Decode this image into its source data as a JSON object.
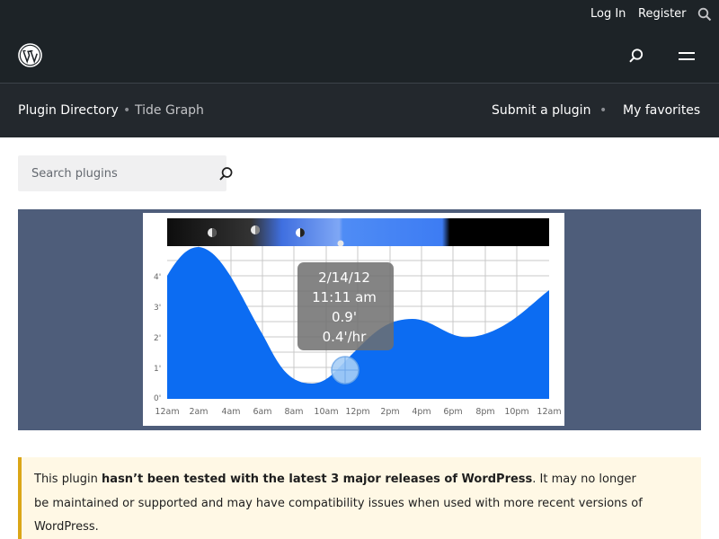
{
  "topbar": {
    "login": "Log In",
    "register": "Register",
    "search_icon": "search-icon"
  },
  "header": {
    "logo_icon": "wordpress-logo",
    "search_icon": "search-icon",
    "menu_icon": "menu-icon"
  },
  "subnav": {
    "breadcrumb_home": "Plugin Directory",
    "breadcrumb_sep": "•",
    "breadcrumb_current": "Tide Graph",
    "submit": "Submit a plugin",
    "sep": "•",
    "favorites": "My favorites"
  },
  "search": {
    "placeholder": "Search plugins",
    "icon": "search-icon"
  },
  "banner": {
    "tooltip": {
      "date": "2/14/12",
      "time": "11:11 am",
      "height": "0.9'",
      "rate": "0.4'/hr"
    },
    "y_ticks": [
      "4'",
      "3'",
      "2'",
      "1'",
      "0'"
    ],
    "x_ticks": [
      "12am",
      "2am",
      "4am",
      "6am",
      "8am",
      "10am",
      "12pm",
      "2pm",
      "4pm",
      "6pm",
      "8pm",
      "10pm",
      "12am"
    ]
  },
  "notice": {
    "prefix": "This plugin ",
    "bold": "hasn’t been tested with the latest 3 major releases of WordPress",
    "suffix": ". It may no longer be maintained or supported and may have compatibility issues when used with more recent versions of WordPress."
  },
  "colors": {
    "dark_bg": "#1d2327",
    "banner_bg": "#4e5d7a",
    "tide_blue": "#0c6cf2",
    "notice_bg": "#fff8e5",
    "notice_border": "#dba617"
  }
}
